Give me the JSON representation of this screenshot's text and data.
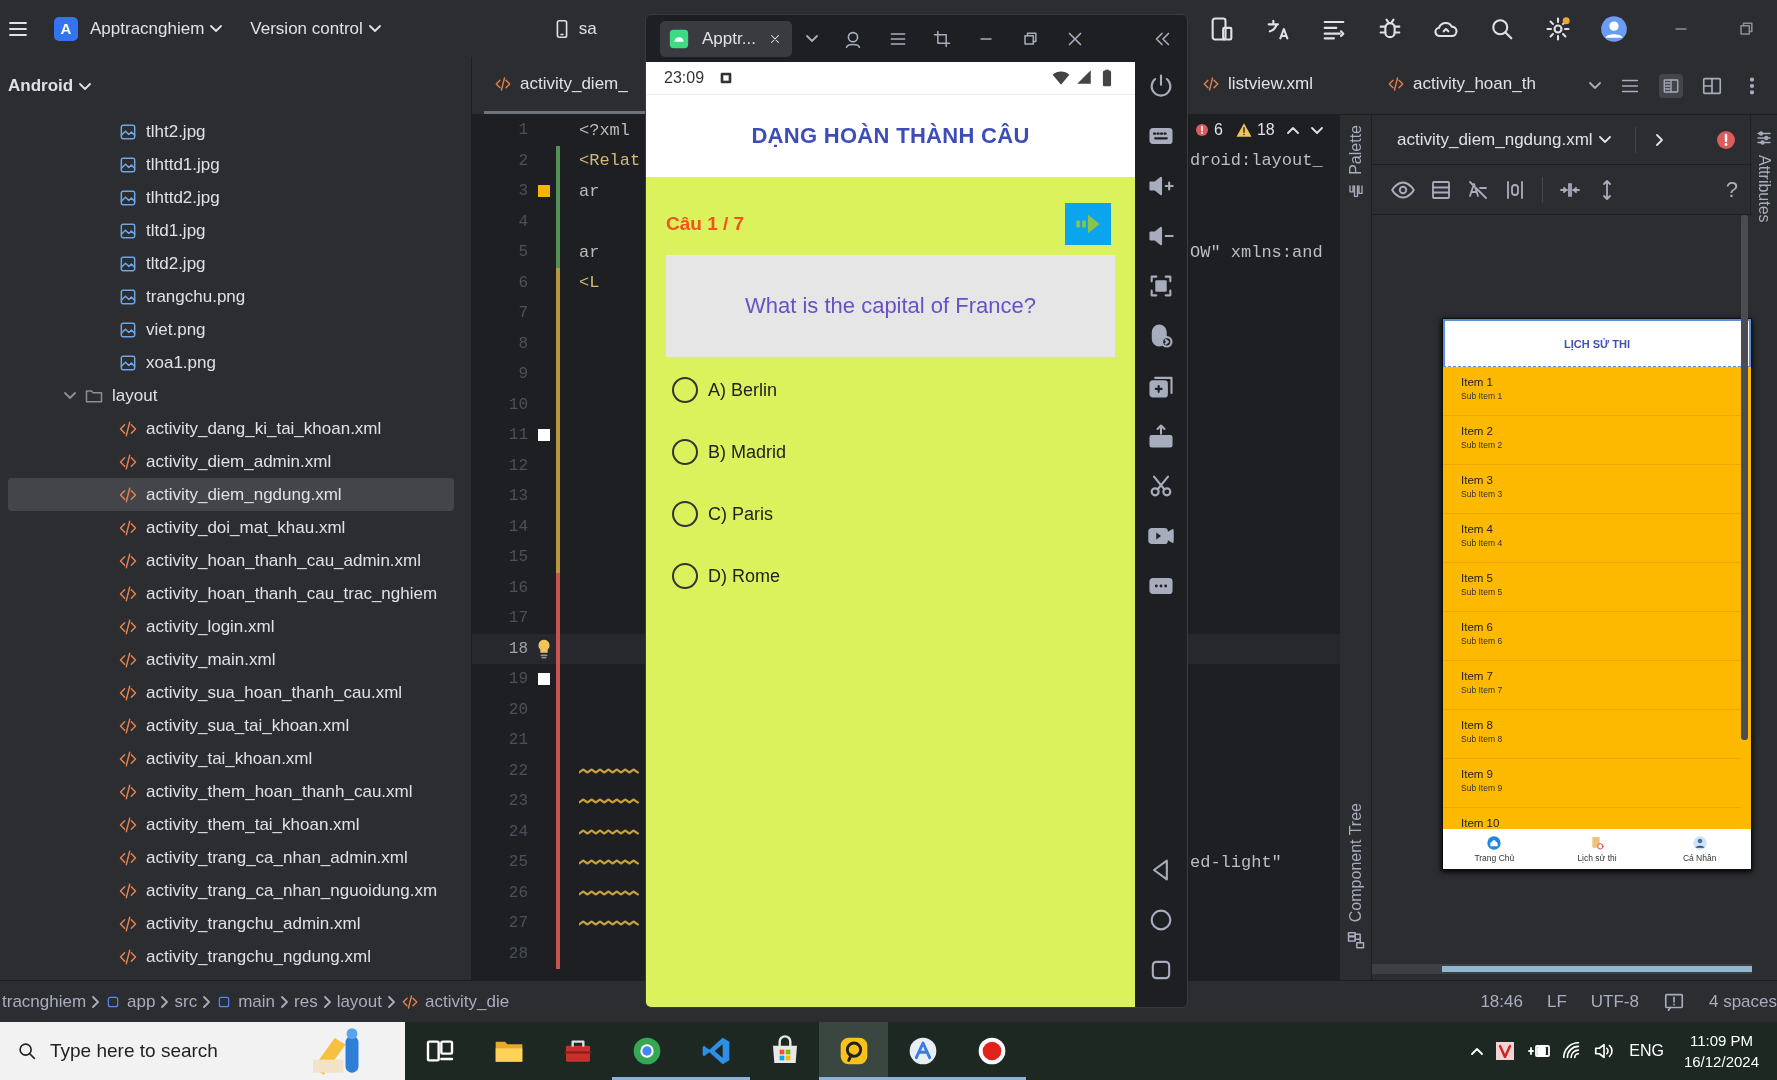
{
  "top_bar": {
    "project_badge": "A",
    "project": "Apptracnghiem",
    "vcs": "Version control",
    "device": "sa"
  },
  "project_panel": {
    "view": "Android",
    "items": [
      {
        "kind": "image",
        "name": "tlht2.jpg",
        "selected": false
      },
      {
        "kind": "image",
        "name": "tlhttd1.jpg",
        "selected": false
      },
      {
        "kind": "image",
        "name": "tlhttd2.jpg",
        "selected": false
      },
      {
        "kind": "image",
        "name": "tltd1.jpg",
        "selected": false
      },
      {
        "kind": "image",
        "name": "tltd2.jpg",
        "selected": false
      },
      {
        "kind": "image",
        "name": "trangchu.png",
        "selected": false
      },
      {
        "kind": "image",
        "name": "viet.png",
        "selected": false
      },
      {
        "kind": "image",
        "name": "xoa1.png",
        "selected": false
      },
      {
        "kind": "folder",
        "name": "layout",
        "expanded": true,
        "selected": false,
        "children": [
          {
            "kind": "xml",
            "name": "activity_dang_ki_tai_khoan.xml",
            "selected": false
          },
          {
            "kind": "xml",
            "name": "activity_diem_admin.xml",
            "selected": false
          },
          {
            "kind": "xml",
            "name": "activity_diem_ngdung.xml",
            "selected": true
          },
          {
            "kind": "xml",
            "name": "activity_doi_mat_khau.xml",
            "selected": false
          },
          {
            "kind": "xml",
            "name": "activity_hoan_thanh_cau_admin.xml",
            "selected": false
          },
          {
            "kind": "xml",
            "name": "activity_hoan_thanh_cau_trac_nghiem",
            "selected": false
          },
          {
            "kind": "xml",
            "name": "activity_login.xml",
            "selected": false
          },
          {
            "kind": "xml",
            "name": "activity_main.xml",
            "selected": false
          },
          {
            "kind": "xml",
            "name": "activity_sua_hoan_thanh_cau.xml",
            "selected": false
          },
          {
            "kind": "xml",
            "name": "activity_sua_tai_khoan.xml",
            "selected": false
          },
          {
            "kind": "xml",
            "name": "activity_tai_khoan.xml",
            "selected": false
          },
          {
            "kind": "xml",
            "name": "activity_them_hoan_thanh_cau.xml",
            "selected": false
          },
          {
            "kind": "xml",
            "name": "activity_them_tai_khoan.xml",
            "selected": false
          },
          {
            "kind": "xml",
            "name": "activity_trang_ca_nhan_admin.xml",
            "selected": false
          },
          {
            "kind": "xml",
            "name": "activity_trang_ca_nhan_nguoidung.xm",
            "selected": false
          },
          {
            "kind": "xml",
            "name": "activity_trangchu_admin.xml",
            "selected": false
          },
          {
            "kind": "xml",
            "name": "activity_trangchu_ngdung.xml",
            "selected": false
          }
        ]
      }
    ]
  },
  "editor": {
    "tabs": [
      {
        "label": "activity_diem_",
        "selected": true
      },
      {
        "label": "listview.xml",
        "selected": false
      },
      {
        "label": "activity_hoan_th",
        "selected": false
      }
    ],
    "inspection": {
      "errors": "6",
      "warnings": "18"
    },
    "lines": [
      {
        "number": "1",
        "text": "<?xml",
        "tag": false,
        "kind": "plain",
        "current": false
      },
      {
        "number": "2",
        "text": "<Relat",
        "tag": true,
        "tail": "droid:layout_",
        "kind": "added",
        "current": false
      },
      {
        "number": "3",
        "text": "ar",
        "tag": false,
        "kind": "added",
        "color": "#f5b400",
        "current": false
      },
      {
        "number": "4",
        "kind": "added",
        "current": false
      },
      {
        "number": "5",
        "text": "ar",
        "tag": false,
        "tail": "OW\" xmlns:and",
        "kind": "added",
        "current": false
      },
      {
        "number": "6",
        "text": "<L",
        "tag": true,
        "kind": "modified",
        "current": false
      },
      {
        "number": "7",
        "kind": "modified",
        "current": false
      },
      {
        "number": "8",
        "kind": "modified",
        "current": false
      },
      {
        "number": "9",
        "kind": "modified",
        "current": false
      },
      {
        "number": "10",
        "kind": "modified",
        "current": false
      },
      {
        "number": "11",
        "kind": "modified",
        "color": "#ffffff",
        "current": false
      },
      {
        "number": "12",
        "kind": "modified",
        "current": false
      },
      {
        "number": "13",
        "kind": "modified",
        "current": false
      },
      {
        "number": "14",
        "kind": "modified",
        "current": false
      },
      {
        "number": "15",
        "kind": "modified",
        "current": false
      },
      {
        "number": "16",
        "kind": "removed",
        "current": false
      },
      {
        "number": "17",
        "kind": "removed",
        "current": false
      },
      {
        "number": "18",
        "kind": "removed",
        "current": true,
        "hint": true
      },
      {
        "number": "19",
        "kind": "removed",
        "color": "#ffffff",
        "current": false
      },
      {
        "number": "20",
        "kind": "removed",
        "current": false
      },
      {
        "number": "21",
        "kind": "removed",
        "current": false
      },
      {
        "number": "22",
        "kind": "removed",
        "current": false,
        "squiggle": true
      },
      {
        "number": "23",
        "kind": "removed",
        "current": false,
        "squiggle": true
      },
      {
        "number": "24",
        "kind": "removed",
        "current": false,
        "squiggle": true
      },
      {
        "number": "25",
        "kind": "removed",
        "current": false,
        "squiggle": true,
        "tail": "ed-light\""
      },
      {
        "number": "26",
        "kind": "removed",
        "current": false,
        "squiggle": true
      },
      {
        "number": "27",
        "kind": "removed",
        "current": false,
        "squiggle": true
      },
      {
        "number": "28",
        "kind": "removed",
        "current": false
      }
    ]
  },
  "emulator": {
    "tab": "Apptr...",
    "phone": {
      "time": "23:09",
      "title": "DẠNG HOÀN THÀNH CÂU",
      "counter": "Câu 1 / 7",
      "question": "What is the capital of France?",
      "options": [
        {
          "label": "A) Berlin",
          "selected": false
        },
        {
          "label": "B) Madrid",
          "selected": false
        },
        {
          "label": "C) Paris",
          "selected": false
        },
        {
          "label": "D) Rome",
          "selected": false
        }
      ]
    }
  },
  "design": {
    "palette": "Palette",
    "component_tree": "Component Tree",
    "attributes": "Attributes",
    "file": "activity_diem_ngdung.xml",
    "help": "?",
    "preview": {
      "title": "LỊCH SỬ THI",
      "items": [
        {
          "title": "Item 1",
          "subtitle": "Sub Item 1"
        },
        {
          "title": "Item 2",
          "subtitle": "Sub Item 2"
        },
        {
          "title": "Item 3",
          "subtitle": "Sub Item 3"
        },
        {
          "title": "Item 4",
          "subtitle": "Sub Item 4"
        },
        {
          "title": "Item 5",
          "subtitle": "Sub Item 5"
        },
        {
          "title": "Item 6",
          "subtitle": "Sub Item 6"
        },
        {
          "title": "Item 7",
          "subtitle": "Sub Item 7"
        },
        {
          "title": "Item 8",
          "subtitle": "Sub Item 8"
        },
        {
          "title": "Item 9",
          "subtitle": "Sub Item 9"
        },
        {
          "title": "Item 10"
        }
      ],
      "nav": [
        {
          "label": "Trang Chủ",
          "kind": "home"
        },
        {
          "label": "Lịch sử thi",
          "kind": "history"
        },
        {
          "label": "Cá Nhân",
          "kind": "profile"
        }
      ]
    }
  },
  "status_bar": {
    "path": [
      {
        "kind": "text",
        "label": "tracnghiem"
      },
      {
        "kind": "module",
        "label": "app"
      },
      {
        "kind": "text",
        "label": "src"
      },
      {
        "kind": "module",
        "label": "main"
      },
      {
        "kind": "text",
        "label": "res"
      },
      {
        "kind": "text",
        "label": "layout"
      },
      {
        "kind": "xml",
        "label": "activity_die"
      }
    ],
    "position": "18:46",
    "line_ending": "LF",
    "encoding": "UTF-8",
    "indent": "4 spaces"
  },
  "taskbar": {
    "search": {
      "placeholder": "Type here to search"
    },
    "apps": [
      {
        "kind": "taskview",
        "running": false,
        "selected": false
      },
      {
        "kind": "folder",
        "running": false,
        "selected": false
      },
      {
        "kind": "toolbox",
        "running": false,
        "selected": false
      },
      {
        "kind": "browser",
        "running": true,
        "selected": false
      },
      {
        "kind": "code",
        "running": true,
        "selected": false
      },
      {
        "kind": "store",
        "running": false,
        "selected": false
      },
      {
        "kind": "ring",
        "running": true,
        "selected": true
      },
      {
        "kind": "assistant",
        "running": true,
        "selected": false
      },
      {
        "kind": "record",
        "running": true,
        "selected": false
      }
    ],
    "language": "ENG",
    "time": "11:09 PM",
    "date": "16/12/2024"
  }
}
